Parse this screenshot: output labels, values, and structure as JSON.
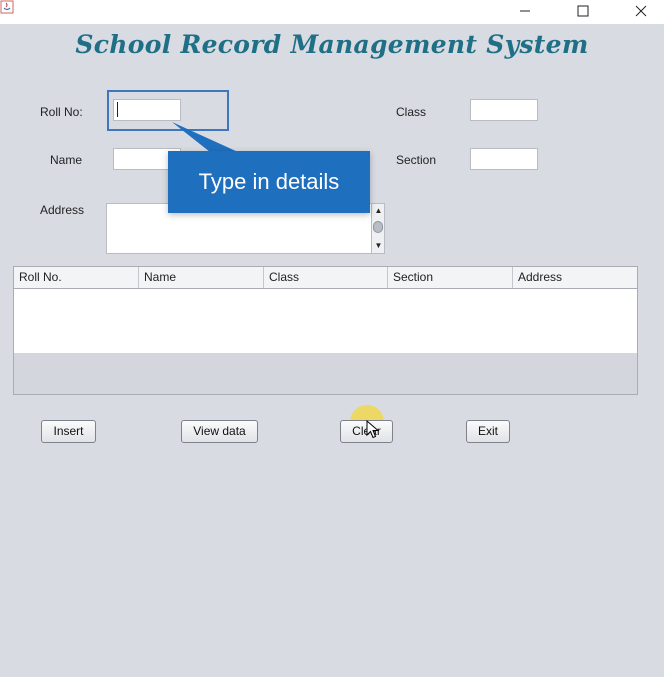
{
  "window": {
    "title": "",
    "controls": {
      "minimize": "—",
      "maximize": "☐",
      "close": "✕"
    }
  },
  "heading": "School Record Management System",
  "form": {
    "roll_no": {
      "label": "Roll No:",
      "value": ""
    },
    "name": {
      "label": "Name",
      "value": ""
    },
    "address": {
      "label": "Address",
      "value": ""
    },
    "class": {
      "label": "Class",
      "value": ""
    },
    "section": {
      "label": "Section",
      "value": ""
    }
  },
  "tooltip": {
    "text": "Type in details",
    "color": "#1f6fbf"
  },
  "table": {
    "columns": [
      "Roll No.",
      "Name",
      "Class",
      "Section",
      "Address"
    ],
    "rows": []
  },
  "buttons": {
    "insert": "Insert",
    "view_data": "View data",
    "clear": "Clear",
    "exit": "Exit"
  },
  "colors": {
    "heading": "#1f6f86",
    "background": "#d8dbe2",
    "focus": "#3d78bf",
    "click_highlight": "#ffd600"
  }
}
